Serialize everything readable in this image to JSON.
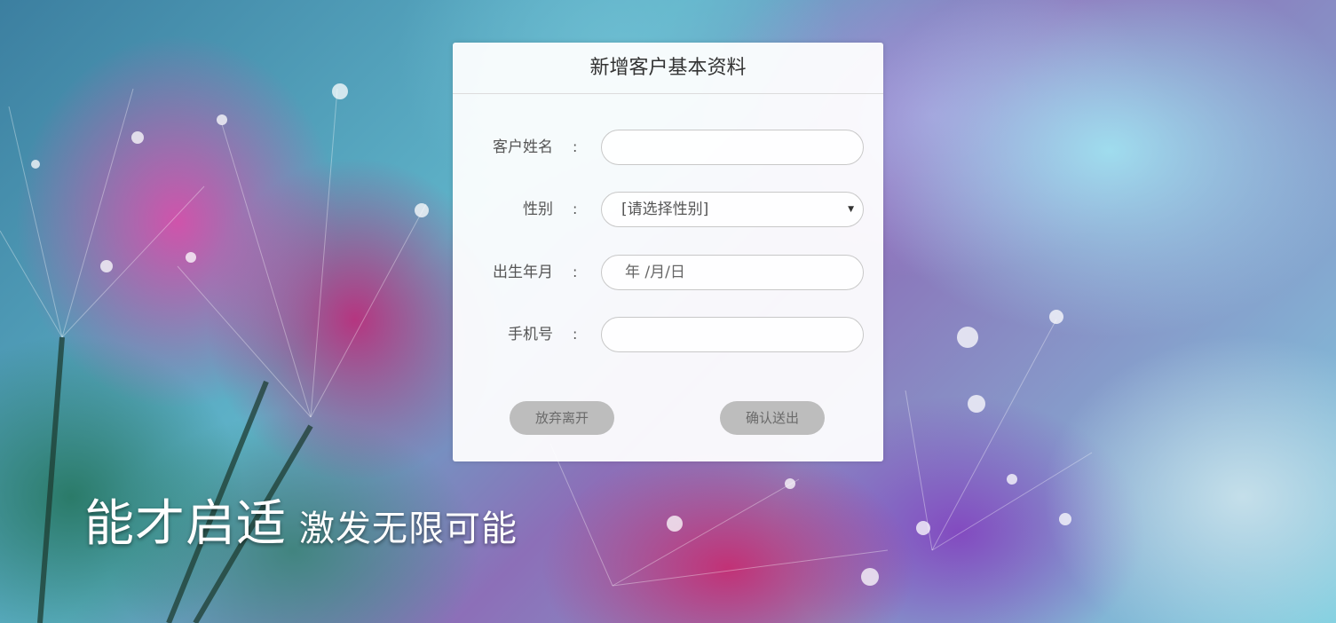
{
  "background": {
    "description_colors": [
      "#3c7fa0",
      "#d650aa",
      "#be2878",
      "#823cbe",
      "#a0e1f0",
      "#287864"
    ]
  },
  "form": {
    "title": "新增客户基本资料",
    "fields": {
      "name": {
        "label": "客户姓名",
        "colon": ":",
        "value": "",
        "placeholder": ""
      },
      "gender": {
        "label": "性别",
        "colon": ":",
        "selected": "[请选择性别]",
        "caret_icon": "caret-down-icon"
      },
      "birth": {
        "label": "出生年月",
        "colon": ":",
        "placeholder_text": "年 /月/日"
      },
      "phone": {
        "label": "手机号",
        "colon": ":",
        "value": "",
        "placeholder": ""
      }
    },
    "buttons": {
      "cancel_label": "放弃离开",
      "submit_label": "确认送出"
    },
    "button_color": "#bdbdbd"
  },
  "slogan": {
    "main": "能才启适",
    "sub": "激发无限可能"
  }
}
